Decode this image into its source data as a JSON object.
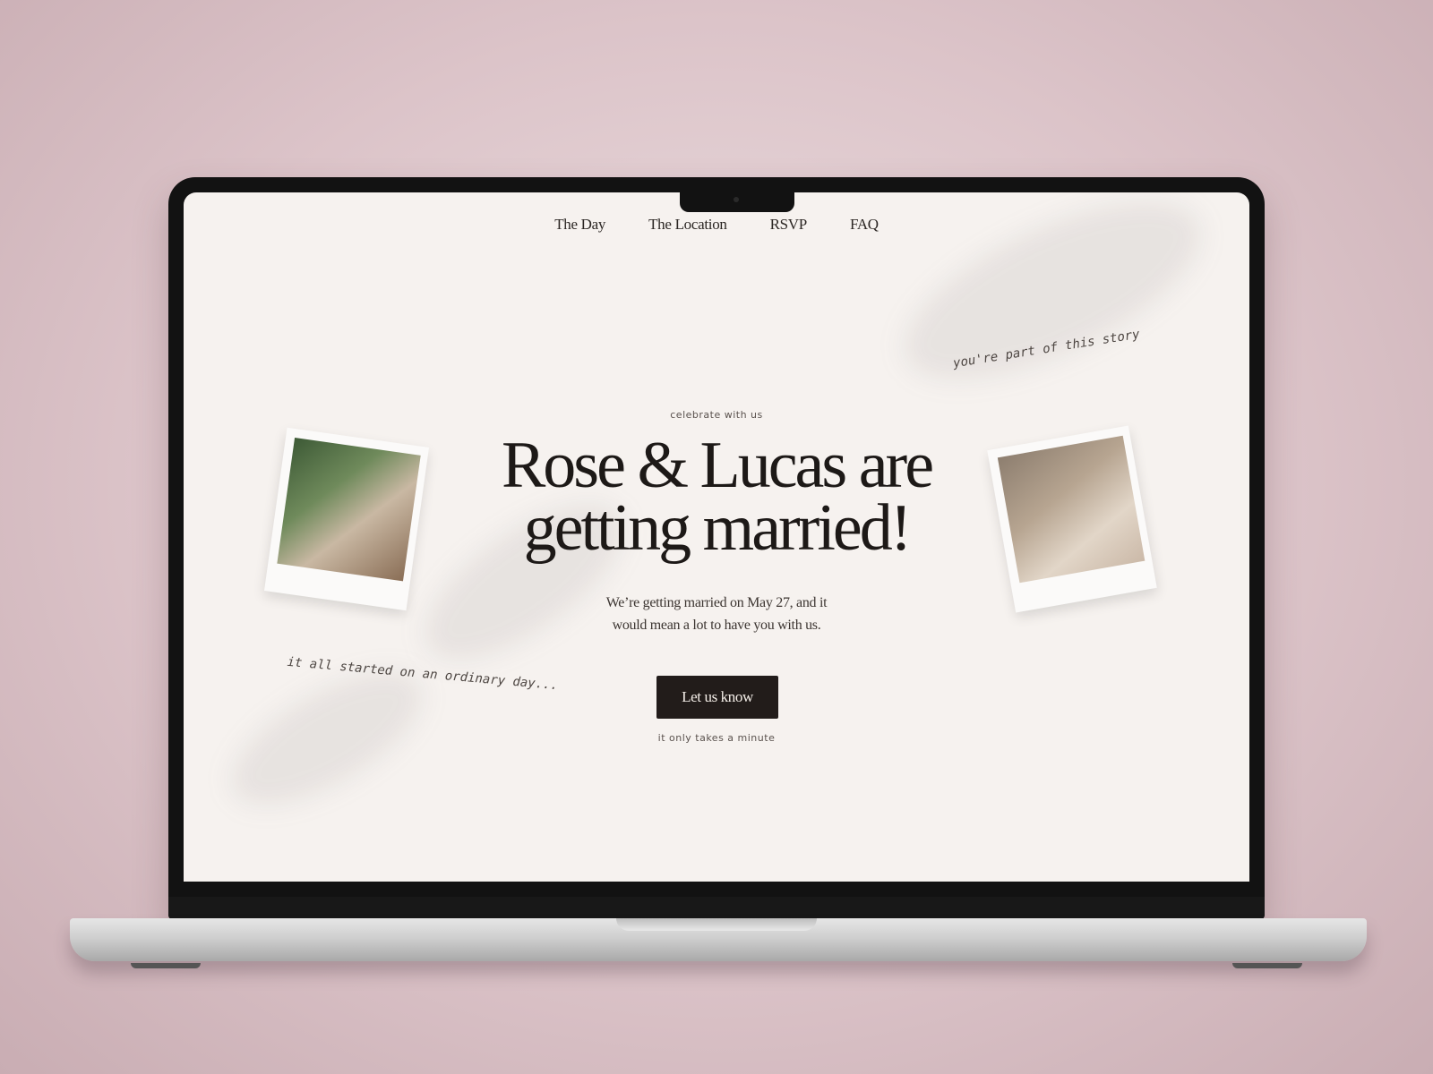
{
  "nav": {
    "items": [
      "The Day",
      "The Location",
      "RSVP",
      "FAQ"
    ]
  },
  "hero": {
    "eyebrow": "celebrate with us",
    "headline_line1": "Rose & Lucas are",
    "headline_line2": "getting married!",
    "subtext": "We’re getting married on May 27, and it would mean a lot to have you with us.",
    "cta_label": "Let us know",
    "cta_note": "it only takes a minute"
  },
  "notes": {
    "left": "it all started on an ordinary day...",
    "right": "you're part of this story"
  },
  "photos": {
    "left_icon": "couple-photo",
    "right_icon": "holding-hands-photo"
  },
  "colors": {
    "background": "#f6f2ef",
    "text": "#1d1917",
    "cta": "#221c1a"
  }
}
